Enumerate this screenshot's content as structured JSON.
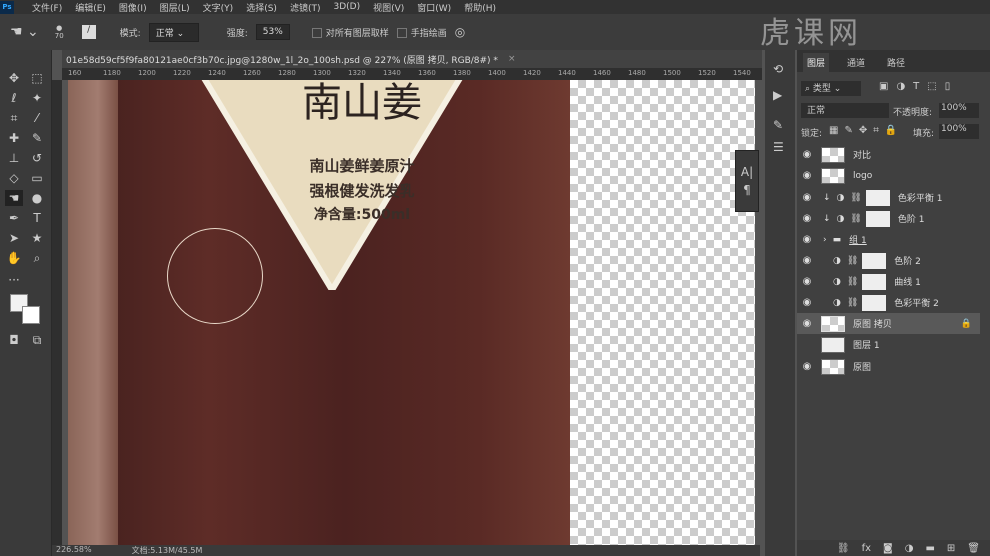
{
  "menu": [
    "文件(F)",
    "编辑(E)",
    "图像(I)",
    "图层(L)",
    "文字(Y)",
    "选择(S)",
    "滤镜(T)",
    "3D(D)",
    "视图(V)",
    "窗口(W)",
    "帮助(H)"
  ],
  "app_icon": "Ps",
  "options": {
    "brush_size": "70",
    "mode_label": "模式:",
    "mode_value": "正常",
    "strength_label": "强度:",
    "strength_value": "53%",
    "sample_all": "对所有图层取样",
    "finger_paint": "手指绘画"
  },
  "document_tab": {
    "title": "01e58d59cf5f9fa80121ae0cf3b70c.jpg@1280w_1l_2o_100sh.psd @ 227% (原图 拷贝, RGB/8#) *",
    "close": "×"
  },
  "ruler_h": [
    "160",
    "1180",
    "1200",
    "1220",
    "1240",
    "1260",
    "1280",
    "1300",
    "1320",
    "1340",
    "1360",
    "1380",
    "1400",
    "1420",
    "1440",
    "1460",
    "1480",
    "1500",
    "1520",
    "1540"
  ],
  "canvas_text": {
    "brand": "南山姜",
    "line1": "南山姜鲜姜原汁",
    "line2": "强根健发洗发乳",
    "line3": "净含量:500ml"
  },
  "status": {
    "zoom": "226.58%",
    "doc": "文档:5.13M/45.5M"
  },
  "watermark": "虎课网",
  "layers_panel": {
    "tabs": [
      "图层",
      "通道",
      "路径"
    ],
    "filter": "类型",
    "blend": "正常",
    "opacity_label": "不透明度:",
    "opacity": "100%",
    "lock_label": "锁定:",
    "fill_label": "填充:",
    "fill": "100%",
    "layers": [
      {
        "name": "对比",
        "visible": true
      },
      {
        "name": "logo",
        "visible": true
      },
      {
        "name": "色彩平衡 1",
        "visible": true
      },
      {
        "name": "色阶 1",
        "visible": true
      },
      {
        "name": "组 1",
        "visible": true
      },
      {
        "name": "色阶 2",
        "visible": true
      },
      {
        "name": "曲线 1",
        "visible": true
      },
      {
        "name": "色彩平衡 2",
        "visible": true
      },
      {
        "name": "原图 拷贝",
        "visible": true,
        "selected": true
      },
      {
        "name": "图层 1",
        "visible": false
      },
      {
        "name": "原图",
        "visible": true
      }
    ],
    "footer_fx": "fx"
  }
}
